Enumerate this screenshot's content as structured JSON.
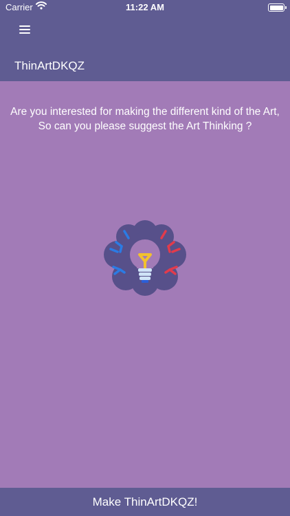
{
  "status_bar": {
    "carrier": "Carrier",
    "time": "11:22 AM"
  },
  "header": {
    "title": "ThinArtDKQZ"
  },
  "main": {
    "question": "Are you interested for making the different kind of the Art, So can you please suggest the Art Thinking ?"
  },
  "footer": {
    "button_label": "Make ThinArtDKQZ!"
  }
}
